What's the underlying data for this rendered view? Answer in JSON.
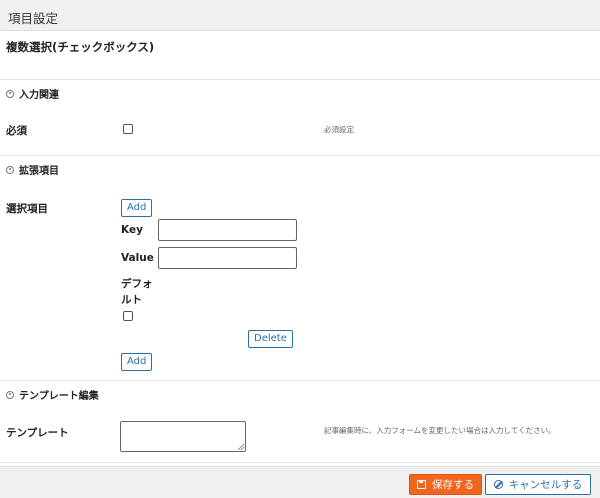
{
  "window": {
    "title": "項目設定"
  },
  "field_type": "複数選択(チェックボックス)",
  "sections": {
    "input": {
      "title": "入力関連"
    },
    "extension": {
      "title": "拡張項目"
    },
    "template": {
      "title": "テンプレート編集"
    }
  },
  "required": {
    "label": "必須",
    "note": "必須設定",
    "checked": false
  },
  "options": {
    "label": "選択項目",
    "add_label": "Add",
    "key_label": "Key",
    "key_value": "",
    "value_label": "Value",
    "value_value": "",
    "default_label_1": "デフォ",
    "default_label_2": "ルト",
    "default_checked": false,
    "delete_label": "Delete",
    "add_bottom_label": "Add"
  },
  "template": {
    "label": "テンプレート",
    "value": "",
    "note": "記事編集時に、入力フォームを変更したい場合は入力してください。"
  },
  "footer": {
    "save_label": "保存する",
    "cancel_label": "キャンセルする"
  },
  "colors": {
    "save_bg": "#f0661f",
    "accent": "#2f6fa7"
  }
}
